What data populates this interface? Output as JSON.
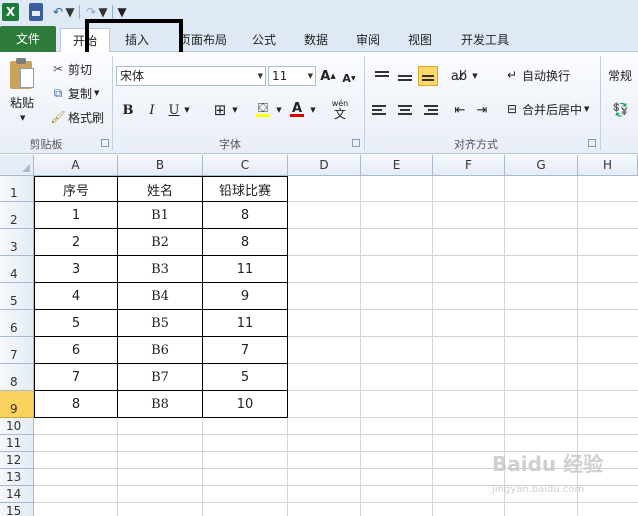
{
  "qat": {
    "app_logo": "X",
    "icons": [
      "excel-logo-icon",
      "save-icon",
      "undo-icon",
      "redo-icon",
      "customize-icon"
    ]
  },
  "tabs": {
    "file": "文件",
    "home": "开始",
    "insert": "插入",
    "page_layout": "页面布局",
    "formulas": "公式",
    "data": "数据",
    "review": "审阅",
    "view": "视图",
    "developer": "开发工具"
  },
  "clipboard": {
    "paste": "粘贴",
    "cut": "剪切",
    "copy": "复制",
    "format_painter": "格式刷",
    "group_label": "剪贴板"
  },
  "font": {
    "name": "宋体",
    "size": "11",
    "bold": "B",
    "italic": "I",
    "underline": "U",
    "phonetic": "wén",
    "phonetic_char": "文",
    "font_color_glyph": "A",
    "group_label": "字体"
  },
  "alignment": {
    "wrap_text": "自动换行",
    "merge_center": "合并后居中",
    "group_label": "对齐方式"
  },
  "number": {
    "format": "常规"
  },
  "columns": [
    "A",
    "B",
    "C",
    "D",
    "E",
    "F",
    "G",
    "H"
  ],
  "rows": [
    "1",
    "2",
    "3",
    "4",
    "5",
    "6",
    "7",
    "8",
    "9",
    "10",
    "11",
    "12",
    "13",
    "14",
    "15"
  ],
  "table": {
    "headers": [
      "序号",
      "姓名",
      "铅球比赛"
    ],
    "rows": [
      [
        "1",
        "B1",
        "8"
      ],
      [
        "2",
        "B2",
        "8"
      ],
      [
        "3",
        "B3",
        "11"
      ],
      [
        "4",
        "B4",
        "9"
      ],
      [
        "5",
        "B5",
        "11"
      ],
      [
        "6",
        "B6",
        "7"
      ],
      [
        "7",
        "B7",
        "5"
      ],
      [
        "8",
        "B8",
        "10"
      ]
    ]
  },
  "watermark": {
    "main": "Baidu 经验",
    "sub": "jingyan.baidu.com"
  },
  "colors": {
    "file_tab": "#2e7c3c",
    "selected_row_header": "#f9d35e",
    "highlight_box": "#000000"
  }
}
